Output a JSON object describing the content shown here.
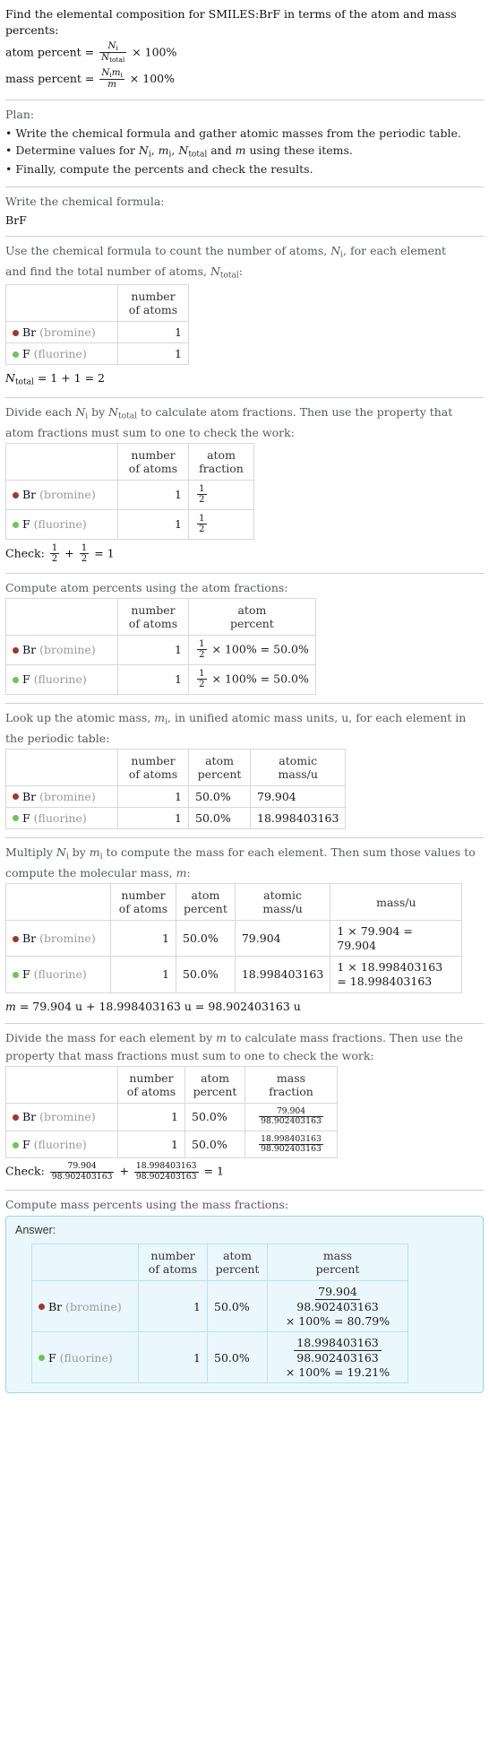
{
  "colors": {
    "bromine": "#9c3a2c",
    "fluorine": "#72c35c",
    "answer_bg": "#eaf7fd",
    "answer_border": "#9fd3e8"
  },
  "intro": {
    "line1": "Find the elemental composition for SMILES:BrF in terms of the atom and mass",
    "line2": "percents:",
    "atom_percent_label": "atom percent = ",
    "mass_percent_label": "mass percent = ",
    "atom_frac_num": "N",
    "atom_frac_num_sub": "i",
    "atom_frac_den": "N",
    "atom_frac_den_sub": "total",
    "mass_frac_num": "N",
    "mass_frac_num_sub": "i",
    "mass_frac_num2": "m",
    "mass_frac_num2_sub": "i",
    "mass_frac_den": "m",
    "times100": "× 100%"
  },
  "plan": {
    "title": "Plan:",
    "items": [
      "• Write the chemical formula and gather atomic masses from the periodic table.",
      "• Determine values for Nᵢ, mᵢ, Nₜₒₜₐₗ and m using these items.",
      "• Finally, compute the percents and check the results."
    ],
    "item2_parts": {
      "pre": "• Determine values for ",
      "n": "N",
      "n_sub": "i",
      "comma1": ", ",
      "m": "m",
      "m_sub": "i",
      "comma2": ", ",
      "ntot": "N",
      "ntot_sub": "total",
      "and": " and ",
      "mm": "m",
      "post": " using these items."
    }
  },
  "formula_step": {
    "prompt": "Write the chemical formula:",
    "value": "BrF"
  },
  "count_step": {
    "prompt_line1_pre": "Use the chemical formula to count the number of atoms, ",
    "prompt_n": "N",
    "prompt_n_sub": "i",
    "prompt_line1_post": ", for each element",
    "prompt_line2_pre": "and find the total number of atoms, ",
    "prompt_ntot": "N",
    "prompt_ntot_sub": "total",
    "prompt_line2_post": ":",
    "headers": [
      "",
      "number\nof atoms"
    ],
    "header_atoms_l1": "number",
    "header_atoms_l2": "of atoms",
    "rows": [
      {
        "symbol": "Br",
        "name": "(bromine)",
        "atoms": "1"
      },
      {
        "symbol": "F",
        "name": "(fluorine)",
        "atoms": "1"
      }
    ],
    "total_label": "N",
    "total_sub": "total",
    "total_expr": " = 1 + 1 = 2"
  },
  "fraction_step": {
    "prompt_line1_pre": "Divide each ",
    "prompt_ni": "N",
    "prompt_ni_sub": "i",
    "prompt_mid": " by ",
    "prompt_ntot": "N",
    "prompt_ntot_sub": "total",
    "prompt_line1_post": " to calculate atom fractions. Then use the property that",
    "prompt_line2": "atom fractions must sum to one to check the work:",
    "header_atoms_l1": "number",
    "header_atoms_l2": "of atoms",
    "header_frac_l1": "atom",
    "header_frac_l2": "fraction",
    "rows": [
      {
        "symbol": "Br",
        "name": "(bromine)",
        "atoms": "1",
        "frac_num": "1",
        "frac_den": "2"
      },
      {
        "symbol": "F",
        "name": "(fluorine)",
        "atoms": "1",
        "frac_num": "1",
        "frac_den": "2"
      }
    ],
    "check_label": "Check: ",
    "check_a_num": "1",
    "check_a_den": "2",
    "check_plus": " + ",
    "check_b_num": "1",
    "check_b_den": "2",
    "check_result": " = 1"
  },
  "atom_percent_step": {
    "prompt": "Compute atom percents using the atom fractions:",
    "header_atoms_l1": "number",
    "header_atoms_l2": "of atoms",
    "header_pct_l1": "atom",
    "header_pct_l2": "percent",
    "rows": [
      {
        "symbol": "Br",
        "name": "(bromine)",
        "atoms": "1",
        "frac_num": "1",
        "frac_den": "2",
        "expr": "× 100% = 50.0%"
      },
      {
        "symbol": "F",
        "name": "(fluorine)",
        "atoms": "1",
        "frac_num": "1",
        "frac_den": "2",
        "expr": "× 100% = 50.0%"
      }
    ]
  },
  "atomic_mass_step": {
    "prompt_line1_pre": "Look up the atomic mass, ",
    "prompt_mi": "m",
    "prompt_mi_sub": "i",
    "prompt_line1_post": ", in unified atomic mass units, u, for each element in",
    "prompt_line2": "the periodic table:",
    "header_atoms_l1": "number",
    "header_atoms_l2": "of atoms",
    "header_pct_l1": "atom",
    "header_pct_l2": "percent",
    "header_mass_l1": "atomic",
    "header_mass_l2": "mass/u",
    "rows": [
      {
        "symbol": "Br",
        "name": "(bromine)",
        "atoms": "1",
        "percent": "50.0%",
        "mass": "79.904"
      },
      {
        "symbol": "F",
        "name": "(fluorine)",
        "atoms": "1",
        "percent": "50.0%",
        "mass": "18.998403163"
      }
    ]
  },
  "molecular_mass_step": {
    "prompt_line1_pre": "Multiply ",
    "prompt_ni": "N",
    "prompt_ni_sub": "i",
    "prompt_by": " by ",
    "prompt_mi": "m",
    "prompt_mi_sub": "i",
    "prompt_line1_post": " to compute the mass for each element. Then sum those values to",
    "prompt_line2_pre": "compute the molecular mass, ",
    "prompt_m": "m",
    "prompt_line2_post": ":",
    "header_atoms_l1": "number",
    "header_atoms_l2": "of atoms",
    "header_pct_l1": "atom",
    "header_pct_l2": "percent",
    "header_amass_l1": "atomic",
    "header_amass_l2": "mass/u",
    "header_mass": "mass/u",
    "rows": [
      {
        "symbol": "Br",
        "name": "(bromine)",
        "atoms": "1",
        "percent": "50.0%",
        "amass": "79.904",
        "mass_l1": "1 × 79.904 = 79.904",
        "mass_l2": ""
      },
      {
        "symbol": "F",
        "name": "(fluorine)",
        "atoms": "1",
        "percent": "50.0%",
        "amass": "18.998403163",
        "mass_l1": "1 × 18.998403163",
        "mass_l2": "= 18.998403163"
      }
    ],
    "sum_m": "m",
    "sum_expr": " = 79.904 u + 18.998403163 u = 98.902403163 u"
  },
  "mass_fraction_step": {
    "prompt_line1_pre": "Divide the mass for each element by ",
    "prompt_m": "m",
    "prompt_line1_post": " to calculate mass fractions. Then use the",
    "prompt_line2": "property that mass fractions must sum to one to check the work:",
    "header_atoms_l1": "number",
    "header_atoms_l2": "of atoms",
    "header_pct_l1": "atom",
    "header_pct_l2": "percent",
    "header_mfrac_l1": "mass",
    "header_mfrac_l2": "fraction",
    "rows": [
      {
        "symbol": "Br",
        "name": "(bromine)",
        "atoms": "1",
        "percent": "50.0%",
        "num": "79.904",
        "den": "98.902403163"
      },
      {
        "symbol": "F",
        "name": "(fluorine)",
        "atoms": "1",
        "percent": "50.0%",
        "num": "18.998403163",
        "den": "98.902403163"
      }
    ],
    "check_label": "Check: ",
    "check_a_num": "79.904",
    "check_a_den": "98.902403163",
    "check_plus": " + ",
    "check_b_num": "18.998403163",
    "check_b_den": "98.902403163",
    "check_result": " = 1"
  },
  "mass_percent_step": {
    "prompt": "Compute mass percents using the mass fractions:",
    "answer_label": "Answer:",
    "header_atoms_l1": "number",
    "header_atoms_l2": "of atoms",
    "header_pct_l1": "atom",
    "header_pct_l2": "percent",
    "header_mpct_l1": "mass",
    "header_mpct_l2": "percent",
    "rows": [
      {
        "symbol": "Br",
        "name": "(bromine)",
        "atoms": "1",
        "percent": "50.0%",
        "num": "79.904",
        "den": "98.902403163",
        "tail": "× 100% = 80.79%"
      },
      {
        "symbol": "F",
        "name": "(fluorine)",
        "atoms": "1",
        "percent": "50.0%",
        "num": "18.998403163",
        "den": "98.902403163",
        "tail": "× 100% = 19.21%"
      }
    ]
  }
}
